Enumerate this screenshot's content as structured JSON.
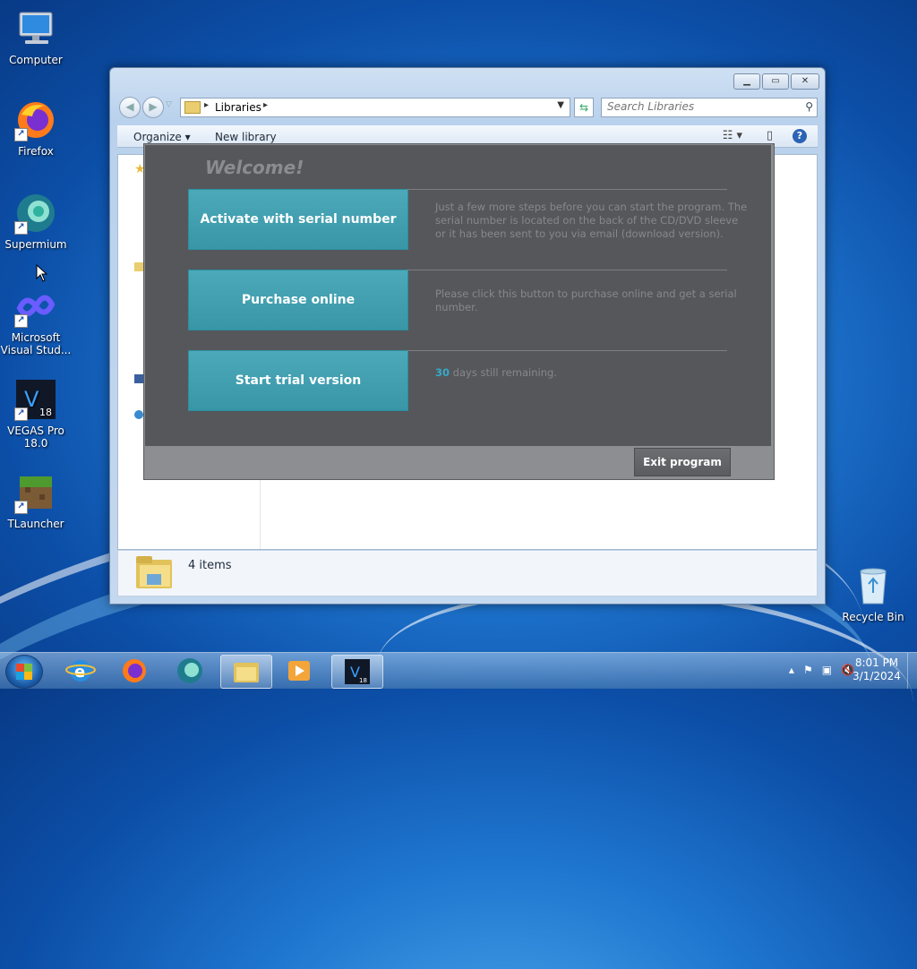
{
  "desktop": {
    "icons": [
      {
        "label": "Computer",
        "glyph": "computer-icon"
      },
      {
        "label": "Firefox",
        "glyph": "firefox-icon"
      },
      {
        "label": "Supermium",
        "glyph": "supermium-icon"
      },
      {
        "label": "Microsoft Visual Stud...",
        "glyph": "visual-studio-icon"
      },
      {
        "label": "VEGAS Pro 18.0",
        "glyph": "vegas-icon"
      },
      {
        "label": "TLauncher",
        "glyph": "tlauncher-icon"
      },
      {
        "label": "Recycle Bin",
        "glyph": "recycle-bin-icon"
      }
    ]
  },
  "explorer": {
    "breadcrumb": "Libraries",
    "search_placeholder": "Search Libraries",
    "toolbar": {
      "organize": "Organize ▾",
      "new_library": "New library"
    },
    "status": {
      "items": "4 items"
    }
  },
  "dialog": {
    "title": "Welcome!",
    "options": [
      {
        "button": "Activate with serial number",
        "description": "Just a few more steps before you can start the program. The serial number is located on the back of the CD/DVD sleeve or it has been sent to you via email (download version)."
      },
      {
        "button": "Purchase online",
        "description": "Please click this button to purchase online and get a serial number."
      },
      {
        "button": "Start trial version",
        "days": "30",
        "description": " days still remaining."
      }
    ],
    "exit": "Exit program"
  },
  "taskbar": {
    "time": "8:01 PM",
    "date": "3/1/2024",
    "apps": [
      "internet-explorer",
      "firefox",
      "supermium",
      "file-explorer",
      "media-player",
      "vegas-pro"
    ]
  }
}
